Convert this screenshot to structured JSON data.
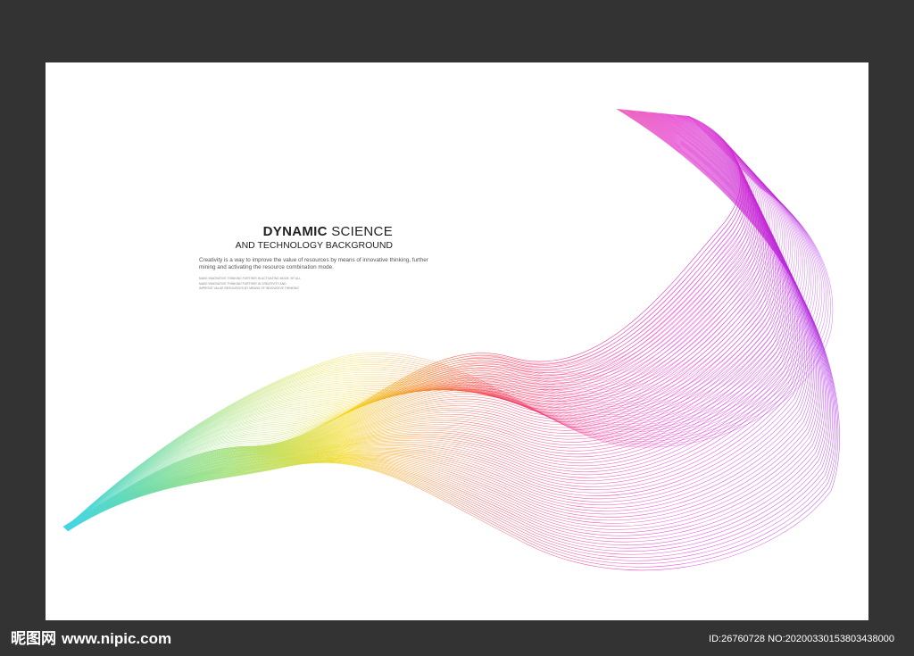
{
  "poster": {
    "title_bold": "DYNAMIC",
    "title_rest": " SCIENCE",
    "subtitle": "AND TECHNOLOGY BACKGROUND",
    "description_line1": "Creativity is a way to improve the value of resources by means of innovative thinking, further",
    "description_line2": "mining and activating the resource combination mode.",
    "fine_print": [
      "MAKE INNOVATIVE THINKING FURTHER IN ACTIVATING MODE. BY ALL",
      "MAKE INNOVATIVE THINKING FURTHER IN CREATIVITY AND",
      "IMPROVE VALUE RESOURCES BY MEANS OF INNOVATIVE THINKING"
    ]
  },
  "watermark": {
    "logo_cn": "昵图网",
    "logo_url": "www.nipic.com",
    "id_text": "ID:26760728 NO:20200330153803438000"
  },
  "colors": {
    "frame": "#333333",
    "canvas": "#ffffff",
    "wave_cyan": "#3fd6e8",
    "wave_yellow": "#f2d400",
    "wave_red": "#f0334e",
    "wave_magenta": "#e11ec7",
    "wave_purple": "#a52de6"
  }
}
